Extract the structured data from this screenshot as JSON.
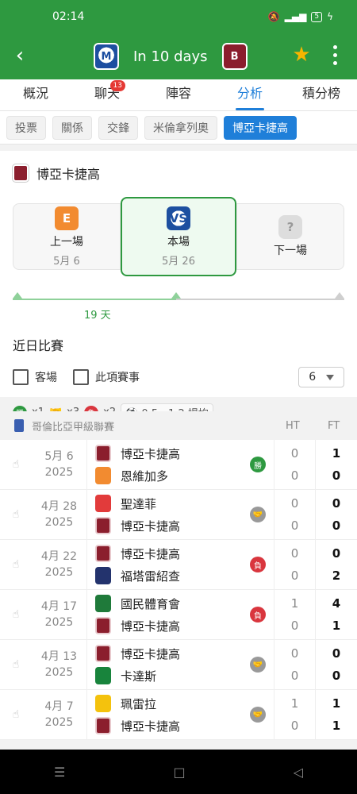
{
  "status": {
    "time": "02:14",
    "battery": "5"
  },
  "header": {
    "title": "In 10 days",
    "home_team": "M",
    "away_team": "B"
  },
  "main_tabs": [
    {
      "label": "概況",
      "badge": ""
    },
    {
      "label": "聊天",
      "badge": "13"
    },
    {
      "label": "陣容",
      "badge": ""
    },
    {
      "label": "分析",
      "badge": ""
    },
    {
      "label": "積分榜",
      "badge": ""
    }
  ],
  "sub_tabs": [
    "投票",
    "關係",
    "交鋒",
    "米倫拿列奧",
    "博亞卡捷高"
  ],
  "team": {
    "name": "博亞卡捷高"
  },
  "match_cards": {
    "prev": {
      "label": "上一場",
      "date": "5月 6"
    },
    "current": {
      "label": "本場",
      "date": "5月 26",
      "vs": "VS"
    },
    "next": {
      "label": "下一場",
      "date": ""
    }
  },
  "timeline": {
    "days": "19 天"
  },
  "recent": {
    "title": "近日比賽",
    "filter_home": "客場",
    "filter_comp": "此項賽事",
    "count": "6",
    "stats": {
      "win_label": "勝",
      "win_count": "x1",
      "draw_count": "x3",
      "loss_label": "負",
      "loss_count": "x2",
      "avg": "0.5 - 1.2 場均"
    }
  },
  "league": {
    "name": "哥倫比亞甲級聯賽",
    "ht": "HT",
    "ft": "FT"
  },
  "matches": [
    {
      "date": "5月 6",
      "year": "2025",
      "home": "博亞卡捷高",
      "away": "恩維加多",
      "home_ht": "0",
      "away_ht": "0",
      "home_ft": "1",
      "away_ft": "0",
      "result": "勝"
    },
    {
      "date": "4月 28",
      "year": "2025",
      "home": "聖達菲",
      "away": "博亞卡捷高",
      "home_ht": "0",
      "away_ht": "0",
      "home_ft": "0",
      "away_ft": "0",
      "result": ""
    },
    {
      "date": "4月 22",
      "year": "2025",
      "home": "博亞卡捷高",
      "away": "福塔雷紹查",
      "home_ht": "0",
      "away_ht": "0",
      "home_ft": "0",
      "away_ft": "2",
      "result": "負"
    },
    {
      "date": "4月 17",
      "year": "2025",
      "home": "國民體育會",
      "away": "博亞卡捷高",
      "home_ht": "1",
      "away_ht": "0",
      "home_ft": "4",
      "away_ft": "1",
      "result": "負"
    },
    {
      "date": "4月 13",
      "year": "2025",
      "home": "博亞卡捷高",
      "away": "卡達斯",
      "home_ht": "0",
      "away_ht": "0",
      "home_ft": "0",
      "away_ft": "0",
      "result": ""
    },
    {
      "date": "4月 7",
      "year": "2025",
      "home": "珮雷拉",
      "away": "博亞卡捷高",
      "home_ht": "1",
      "away_ht": "0",
      "home_ft": "1",
      "away_ft": "1",
      "result": ""
    }
  ]
}
